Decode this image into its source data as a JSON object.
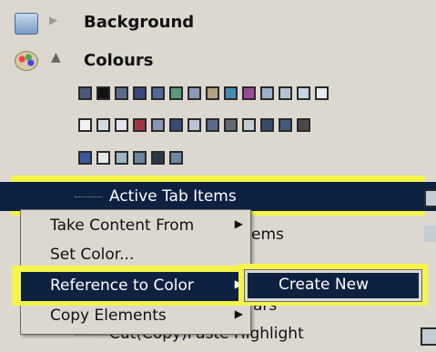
{
  "tree": {
    "background_label": "Background",
    "colours_label": "Colours",
    "active_tab_label": "Active Tab Items",
    "partial_items_label": "ems",
    "partial_ars_label": "ars",
    "cut_copy_label": "Cut(Copy)Paste Highlight"
  },
  "swatch_rows": [
    [
      "#4a5a7a",
      "#111111",
      "#5c6c8c",
      "#364a7c",
      "#4e6a9a",
      "#5a9a7a",
      "#8a9ab4",
      "#b4a484",
      "#4a8ab4",
      "#9a4a9a",
      "#9ab4cc",
      "#b4c4d4",
      "#c4d4e4",
      "#e4ecf4"
    ],
    [
      "#f4f4f4",
      "#d4dce4",
      "#e4e4ec",
      "#a43444",
      "#8a94b4",
      "#3a4a7a",
      "#bcc4d4",
      "#5a6c8c",
      "#646a74",
      "#c4ccd4",
      "#3a4a6c",
      "#445a7c",
      "#4a4a4a"
    ],
    [
      "#3a5a9a",
      "#e4e8ec",
      "#9ab4c4",
      "#6a84a4",
      "#2a3a4a",
      "#6a8aa4"
    ]
  ],
  "context_menu": {
    "items": [
      {
        "label": "Take Content From",
        "arrow": "▶"
      },
      {
        "label": "Set Color...",
        "arrow": ""
      },
      {
        "label": "Reference to Color",
        "arrow": "▶"
      },
      {
        "label": "Copy Elements",
        "arrow": "▶"
      }
    ]
  },
  "submenu": {
    "create_new": "Create New"
  },
  "colors": {
    "highlight_yellow": "#f4f44a",
    "selection_navy": "#0e2140",
    "menu_bg": "#dcd8d0"
  }
}
